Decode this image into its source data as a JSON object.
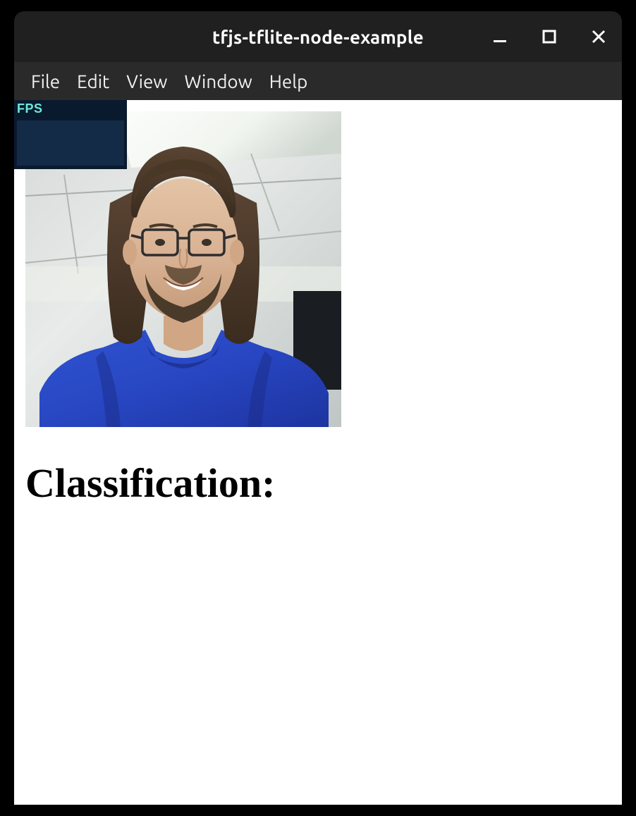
{
  "window": {
    "title": "tfjs-tflite-node-example"
  },
  "menubar": {
    "items": [
      "File",
      "Edit",
      "View",
      "Window",
      "Help"
    ]
  },
  "fps": {
    "label": "FPS"
  },
  "content": {
    "heading": "Classification:"
  }
}
